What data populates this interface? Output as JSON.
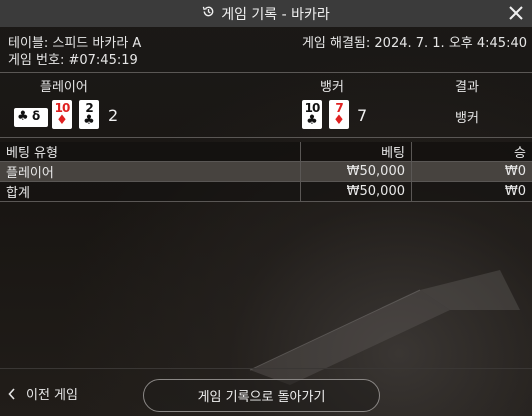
{
  "header": {
    "title": "게임 기록 - 바카라",
    "history_icon": "history-icon",
    "close_icon": "close-icon"
  },
  "info": {
    "table_label": "테이블: 스피드 바카라 A",
    "settled_label": "게임 해결됨: 2024. 7. 1. 오후 4:45:40",
    "game_number_label": "게임 번호: #07:45:19"
  },
  "result": {
    "player_header": "플레이어",
    "banker_header": "뱅커",
    "outcome_header": "결과",
    "player_cards": [
      {
        "rank": "10",
        "suit": "♦",
        "color": "red"
      },
      {
        "rank": "2",
        "suit": "♣",
        "color": "black"
      }
    ],
    "player_score": "2",
    "banker_cards": [
      {
        "rank": "10",
        "suit": "♣",
        "color": "black"
      },
      {
        "rank": "7",
        "suit": "♦",
        "color": "red"
      }
    ],
    "banker_score": "7",
    "outcome": "뱅커"
  },
  "bets": {
    "headers": {
      "type": "베팅 유형",
      "bet": "베팅",
      "win": "승"
    },
    "rows": [
      {
        "type": "플레이어",
        "bet": "₩50,000",
        "win": "₩0"
      }
    ],
    "total": {
      "type": "합계",
      "bet": "₩50,000",
      "win": "₩0"
    }
  },
  "footer": {
    "prev_game": "이전 게임",
    "back": "게임 기록으로 돌아가기"
  },
  "colors": {
    "header_bg": "#3b3b3b",
    "red_suit": "#e02020",
    "highlight_row": "#47433f"
  }
}
